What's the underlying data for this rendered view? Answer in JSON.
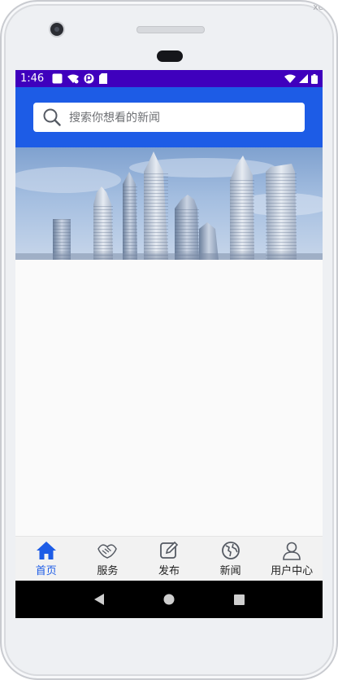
{
  "device": {
    "corner_label": "xel ⌄"
  },
  "status_bar": {
    "time": "1:46"
  },
  "search": {
    "placeholder": "搜索你想看的新闻"
  },
  "banner": {
    "description_icon": "city-skyline-image"
  },
  "bottom_nav": {
    "items": [
      {
        "label": "首页",
        "icon": "home-icon",
        "active": true
      },
      {
        "label": "服务",
        "icon": "handshake-icon",
        "active": false
      },
      {
        "label": "发布",
        "icon": "edit-icon",
        "active": false
      },
      {
        "label": "新闻",
        "icon": "globe-icon",
        "active": false
      },
      {
        "label": "用户中心",
        "icon": "user-icon",
        "active": false
      }
    ]
  },
  "colors": {
    "status_bar": "#3f00bd",
    "header": "#1d5ce6",
    "accent": "#1d5ce6",
    "nav_bg": "#f2f2f2",
    "system_nav": "#000000"
  }
}
